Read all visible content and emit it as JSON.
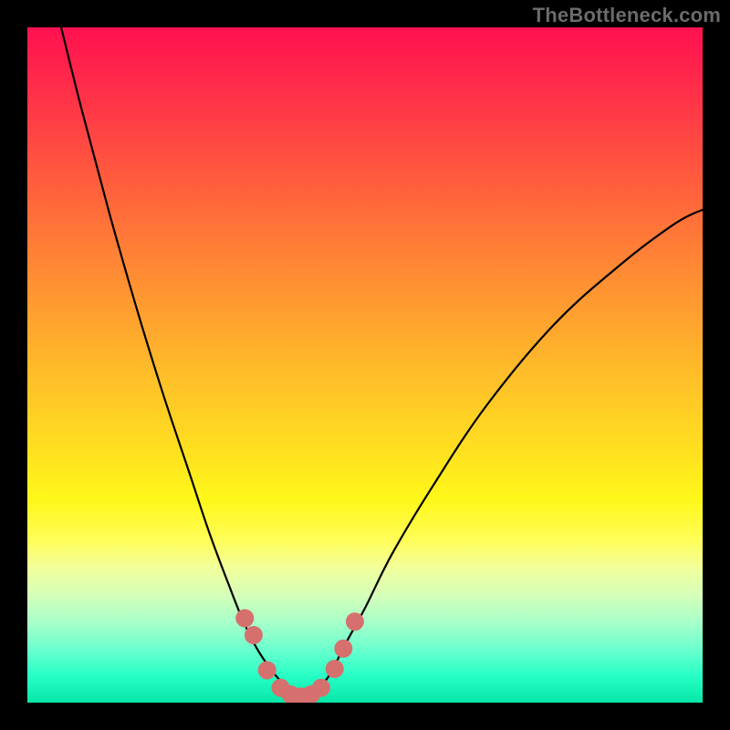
{
  "watermark": "TheBottleneck.com",
  "colors": {
    "frame_bg": "#000000",
    "watermark_text": "#6b6b6b",
    "curve_stroke": "#000000",
    "marker_fill": "#d6706f"
  },
  "chart_data": {
    "type": "line",
    "title": "",
    "xlabel": "",
    "ylabel": "",
    "xlim": [
      0,
      100
    ],
    "ylim": [
      0,
      100
    ],
    "grid": false,
    "legend": false,
    "series": [
      {
        "name": "left-curve",
        "x": [
          3,
          5,
          8,
          12,
          16,
          20,
          24,
          27,
          30,
          32,
          34,
          36,
          37.5,
          39,
          40,
          41
        ],
        "y": [
          108,
          100,
          88,
          73,
          59,
          46,
          34,
          25,
          17,
          12,
          8,
          5,
          3.2,
          1.8,
          1.0,
          0.7
        ]
      },
      {
        "name": "right-curve",
        "x": [
          41,
          42,
          43.5,
          45,
          47,
          50,
          54,
          60,
          68,
          78,
          88,
          96,
          100
        ],
        "y": [
          0.7,
          1.2,
          2.5,
          4.5,
          8.5,
          14,
          22,
          32,
          44,
          56,
          65,
          71,
          73
        ]
      }
    ],
    "markers": {
      "name": "highlighted-points",
      "x": [
        32.2,
        33.5,
        35.5,
        37.5,
        39.0,
        40.5,
        42.0,
        43.5,
        45.5,
        46.8,
        48.5
      ],
      "y": [
        12.5,
        10.0,
        4.8,
        2.2,
        1.2,
        0.9,
        1.2,
        2.2,
        5.0,
        8.0,
        12.0
      ],
      "color": "#d6706f",
      "radius": 10
    },
    "background_gradient": {
      "direction": "vertical",
      "stops": [
        {
          "pos": 0.0,
          "color": "#ff1150"
        },
        {
          "pos": 0.08,
          "color": "#ff2a4a"
        },
        {
          "pos": 0.22,
          "color": "#ff5a3e"
        },
        {
          "pos": 0.36,
          "color": "#ff8a34"
        },
        {
          "pos": 0.5,
          "color": "#ffb92a"
        },
        {
          "pos": 0.64,
          "color": "#ffe41f"
        },
        {
          "pos": 0.7,
          "color": "#fff81a"
        },
        {
          "pos": 0.76,
          "color": "#fffd5a"
        },
        {
          "pos": 0.8,
          "color": "#f2ff9a"
        },
        {
          "pos": 0.84,
          "color": "#d6ffb8"
        },
        {
          "pos": 0.88,
          "color": "#a9ffc9"
        },
        {
          "pos": 0.92,
          "color": "#6dffce"
        },
        {
          "pos": 0.96,
          "color": "#28ffc6"
        },
        {
          "pos": 1.0,
          "color": "#07e6a7"
        }
      ]
    }
  }
}
